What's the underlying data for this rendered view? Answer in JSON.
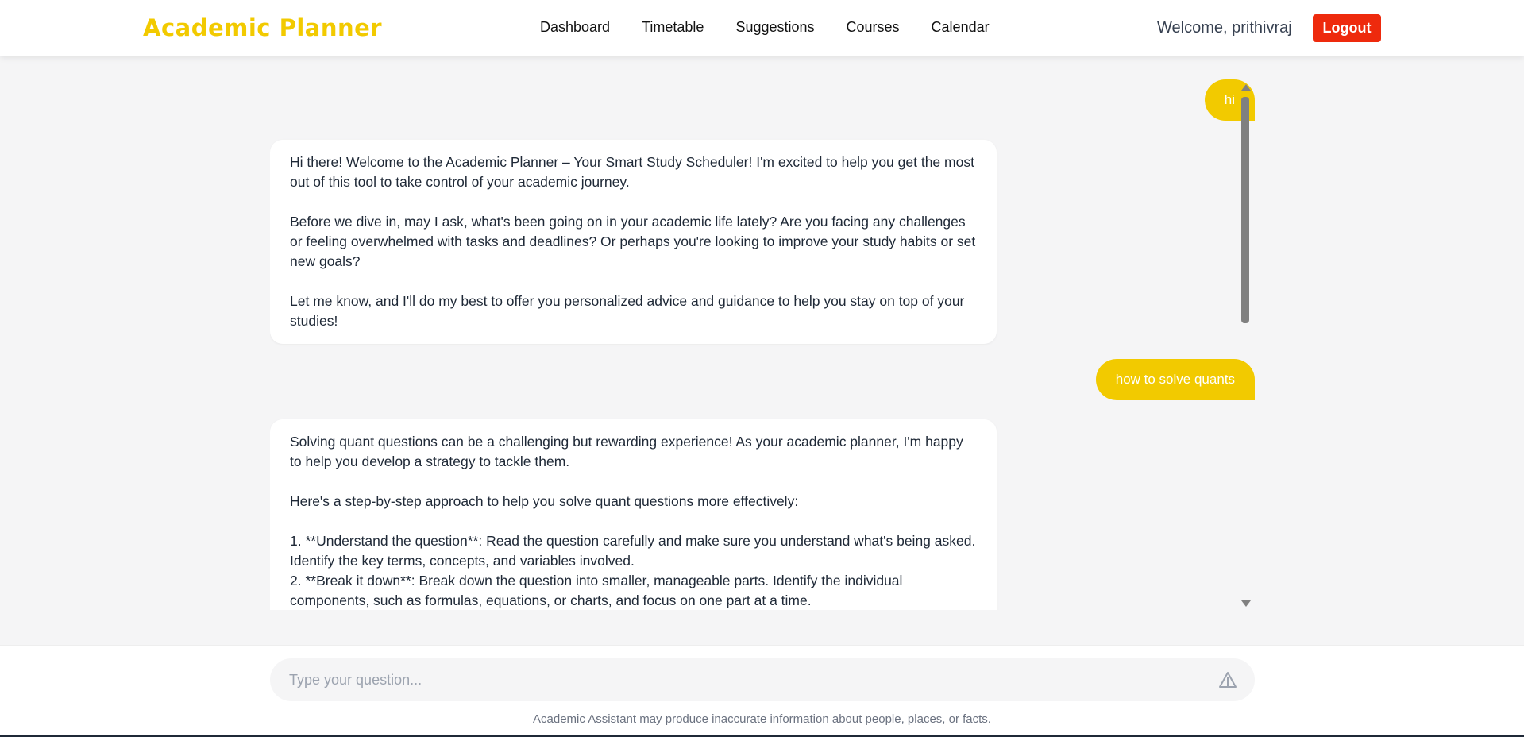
{
  "header": {
    "brand": "Academic Planner",
    "nav": [
      "Dashboard",
      "Timetable",
      "Suggestions",
      "Courses",
      "Calendar"
    ],
    "welcome": "Welcome, prithivraj",
    "logout_label": "Logout"
  },
  "chat": {
    "messages": [
      {
        "role": "user",
        "text": "hi"
      },
      {
        "role": "assistant",
        "paragraphs": [
          "Hi there! Welcome to the Academic Planner – Your Smart Study Scheduler! I'm excited to help you get the most out of this tool to take control of your academic journey.",
          "Before we dive in, may I ask, what's been going on in your academic life lately? Are you facing any challenges or feeling overwhelmed with tasks and deadlines? Or perhaps you're looking to improve your study habits or set new goals?",
          "Let me know, and I'll do my best to offer you personalized advice and guidance to help you stay on top of your studies!"
        ]
      },
      {
        "role": "user",
        "text": "how to solve quants"
      },
      {
        "role": "assistant",
        "paragraphs": [
          "Solving quant questions can be a challenging but rewarding experience! As your academic planner, I'm happy to help you develop a strategy to tackle them.",
          "Here's a step-by-step approach to help you solve quant questions more effectively:"
        ],
        "list": [
          "1. **Understand the question**: Read the question carefully and make sure you understand what's being asked. Identify the key terms, concepts, and variables involved.",
          "2. **Break it down**: Break down the question into smaller, manageable parts. Identify the individual components, such as formulas, equations, or charts, and focus on one part at a time."
        ]
      }
    ]
  },
  "composer": {
    "placeholder": "Type your question...",
    "disclaimer": "Academic Assistant may produce inaccurate information about people, places, or facts."
  },
  "colors": {
    "brand": "#f2ca00",
    "logout": "#ee2a0d",
    "user_bubble": "#f2ca00"
  }
}
